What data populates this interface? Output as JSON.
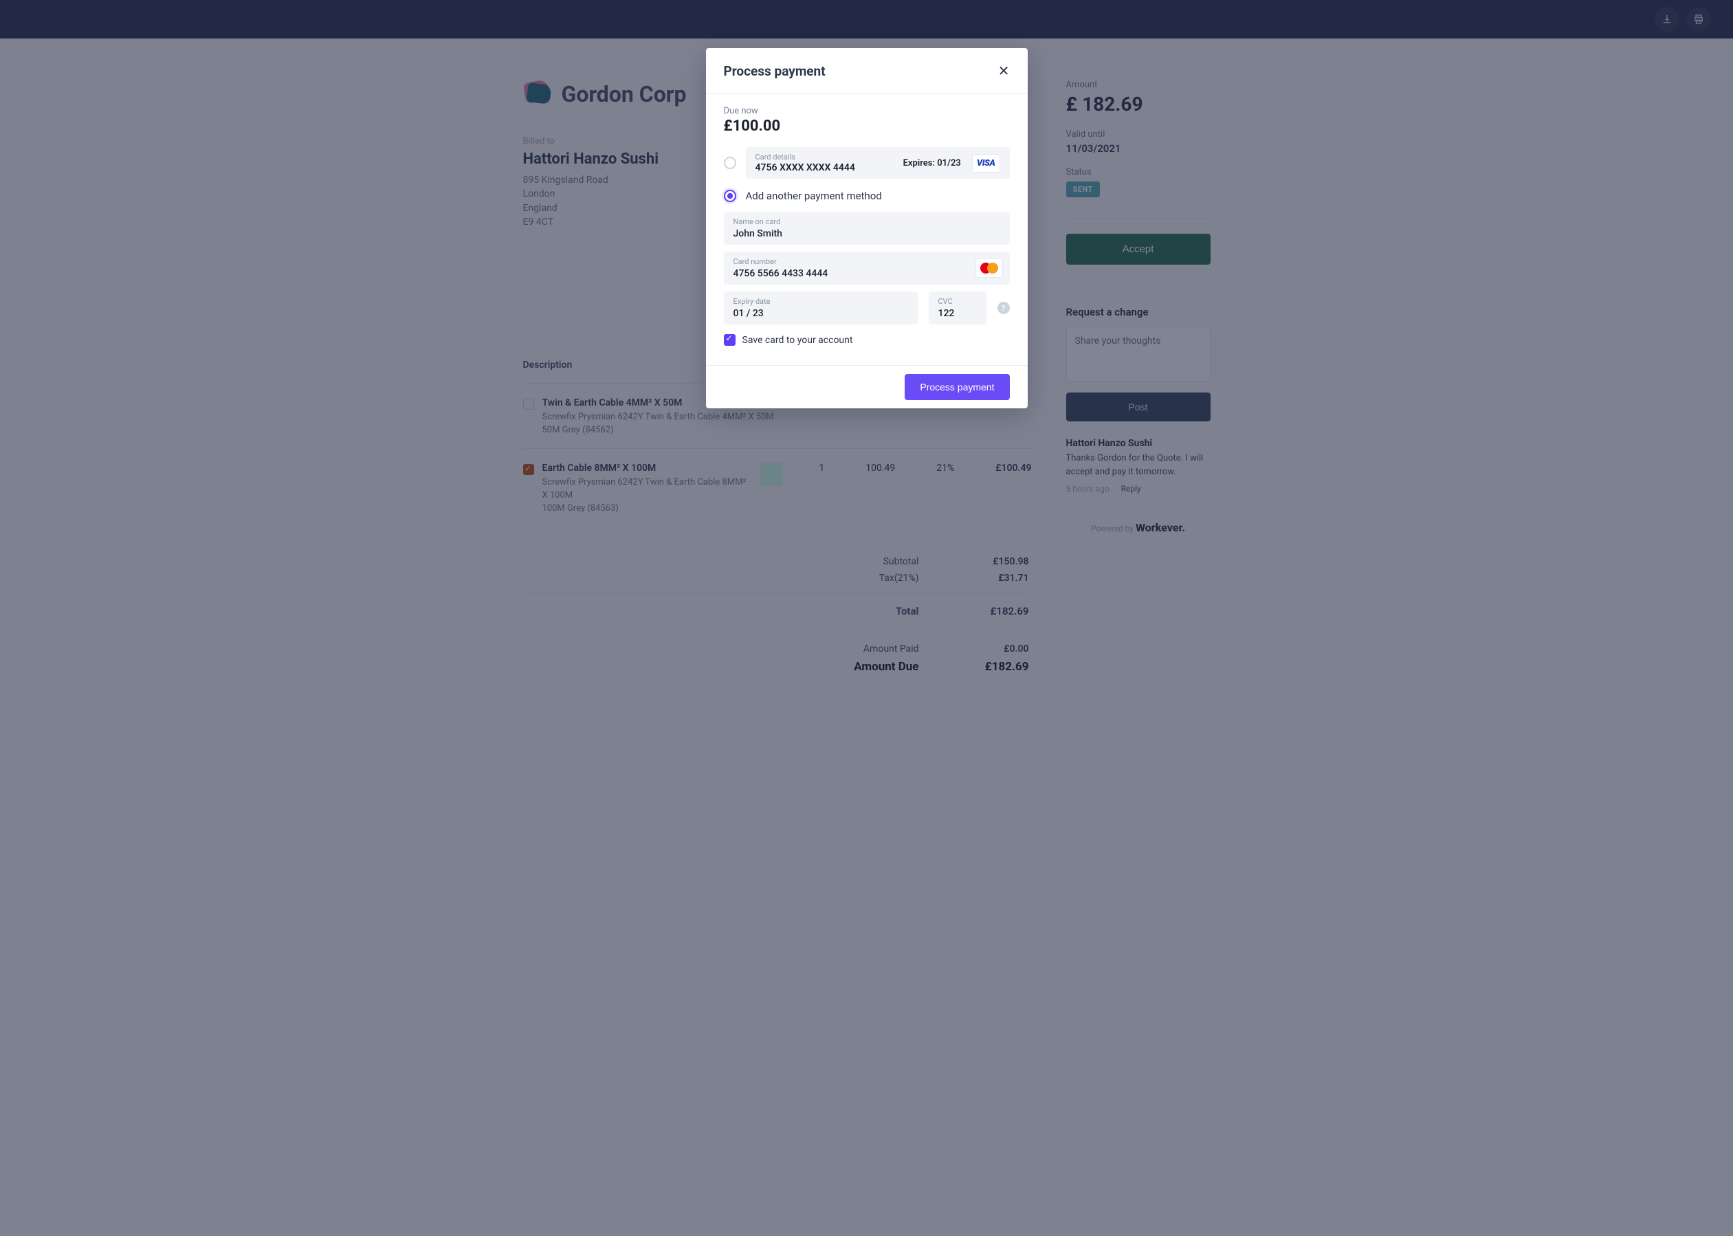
{
  "topbar": {
    "download_icon": "download",
    "print_icon": "print"
  },
  "company": {
    "name": "Gordon Corp"
  },
  "billed": {
    "label": "Billed to",
    "name": "Hattori Hanzo Sushi",
    "address1": "895 Kingsland Road",
    "city": "London",
    "country": "England",
    "postcode": "E9 4CT"
  },
  "table": {
    "header_description": "Description",
    "items": [
      {
        "checked": false,
        "title": "Twin & Earth Cable 4MM² X 50M",
        "sub1": "Screwfix Prysmian 6242Y Twin & Earth Cable 4MM² X 50M",
        "sub2": "50M Grey (84562)",
        "qty": "",
        "price": "",
        "tax": "",
        "line_total": ""
      },
      {
        "checked": true,
        "title": "Earth Cable 8MM² X 100M",
        "sub1": "Screwfix Prysmian 6242Y Twin & Earth Cable 8MM² X 100M",
        "sub2": "100M Grey (84563)",
        "qty": "1",
        "price": "100.49",
        "tax": "21%",
        "line_total": "£100.49"
      }
    ]
  },
  "totals": {
    "subtotal_label": "Subtotal",
    "subtotal_value": "£150.98",
    "tax_label": "Tax(21%)",
    "tax_value": "£31.71",
    "total_label": "Total",
    "total_value": "£182.69",
    "paid_label": "Amount Paid",
    "paid_value": "£0.00",
    "due_label": "Amount Due",
    "due_value": "£182.69"
  },
  "sidebar": {
    "amount_label": "Amount",
    "amount_value": "£ 182.69",
    "valid_label": "Valid until",
    "valid_value": "11/03/2021",
    "status_label": "Status",
    "status_badge": "SENT",
    "accept_label": "Accept",
    "request_title": "Request a change",
    "thoughts_placeholder": "Share your thoughts",
    "post_label": "Post",
    "comment_author": "Hattori Hanzo Sushi",
    "comment_body": "Thanks Gordon for the Quote. I will accept and pay it tomorrow.",
    "comment_time": "5 hours ago",
    "comment_reply": "Reply",
    "powered_prefix": "Powered by ",
    "powered_brand": "Workever."
  },
  "modal": {
    "title": "Process payment",
    "due_label": "Due now",
    "due_value": "£100.00",
    "saved_card": {
      "details_label": "Card details",
      "number": "4756 XXXX XXXX 4444",
      "expires_label": "Expires: 01/23"
    },
    "add_label": "Add another payment method",
    "name_label": "Name on card",
    "name_value": "John Smith",
    "number_label": "Card number",
    "number_value": "4756 5566 4433 4444",
    "expiry_label": "Expiry date",
    "expiry_value": "01 / 23",
    "cvc_label": "CVC",
    "cvc_value": "122",
    "save_label": "Save card to your account",
    "process_button": "Process payment"
  }
}
